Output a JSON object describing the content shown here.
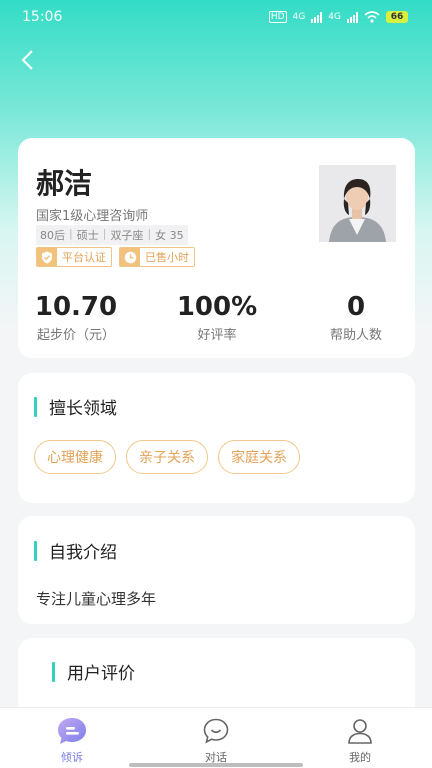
{
  "status_bar": {
    "time": "15:06",
    "network_hd": "HD",
    "signal1": "4G",
    "signal2": "4G",
    "battery": "66"
  },
  "counselor": {
    "name": "郝洁",
    "title": "国家1级心理咨询师",
    "tags": [
      "80后",
      "硕士",
      "双子座",
      "女 35"
    ],
    "badges": [
      "平台认证",
      "已售小时"
    ]
  },
  "stats": [
    {
      "value": "10.70",
      "label": "起步价（元）"
    },
    {
      "value": "100%",
      "label": "好评率"
    },
    {
      "value": "0",
      "label": "帮助人数"
    }
  ],
  "expertise": {
    "title": "擅长领域",
    "items": [
      "心理健康",
      "亲子关系",
      "家庭关系"
    ]
  },
  "intro": {
    "title": "自我介绍",
    "text": "专注儿童心理多年"
  },
  "reviews": {
    "title": "用户评价"
  },
  "tabbar": {
    "items": [
      {
        "label": "倾诉",
        "icon": "chat-bubble-icon"
      },
      {
        "label": "对话",
        "icon": "dialog-icon"
      },
      {
        "label": "我的",
        "icon": "profile-icon"
      }
    ]
  },
  "colors": {
    "accent": "#2ed3bf",
    "gold": "#e3a357",
    "tab_active": "#7b7ee8"
  }
}
